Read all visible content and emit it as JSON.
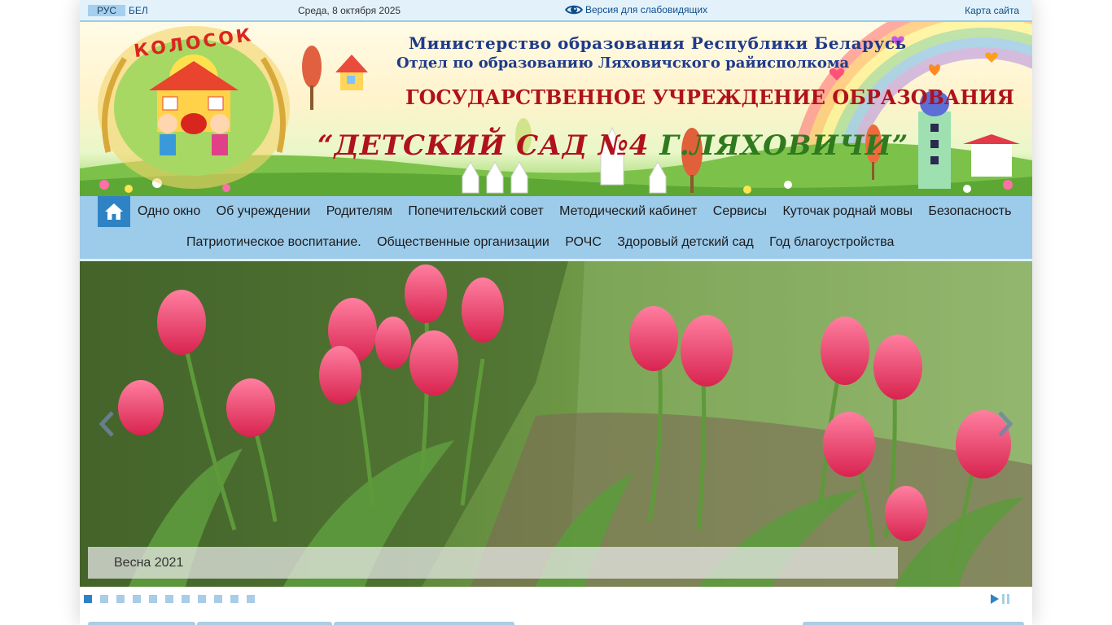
{
  "topbar": {
    "lang_rus": "РУС",
    "lang_bel": "БЕЛ",
    "date": "Среда, 8 октября 2025",
    "vision_label": "Версия для слабовидящих",
    "sitemap": "Карта сайта"
  },
  "banner": {
    "logo_text": "КОЛОСОК",
    "ministry": "Министерство образования Республики Беларусь",
    "department": "Отдел по образованию Ляховичского райисполкома",
    "institution": "Государственное учреждение образования",
    "name_part1": "“ДЕТСКИЙ САД №4",
    "name_part2": "Г.ЛЯХОВИЧИ”"
  },
  "menu": {
    "home_icon": "home-icon",
    "row1": [
      "Одно окно",
      "Об учреждении",
      "Родителям",
      "Попечительский совет",
      "Методический кабинет",
      "Сервисы",
      "Куточак роднай мовы",
      "Безопасность"
    ],
    "row2": [
      "Патриотическое воспитание.",
      "Общественные организации",
      "РОЧС",
      "Здоровый детский сад",
      "Год благоустройства"
    ]
  },
  "slider": {
    "caption": "Весна 2021",
    "slide_count": 11,
    "active_slide": 1,
    "prev_icon": "chevron-left-icon",
    "next_icon": "chevron-right-icon",
    "play_icon": "play-icon",
    "pause_icon": "pause-icon"
  },
  "colors": {
    "menu_bg": "#9dcbea",
    "accent": "#2f83c4",
    "topbar_bg": "#e3f1fb"
  }
}
